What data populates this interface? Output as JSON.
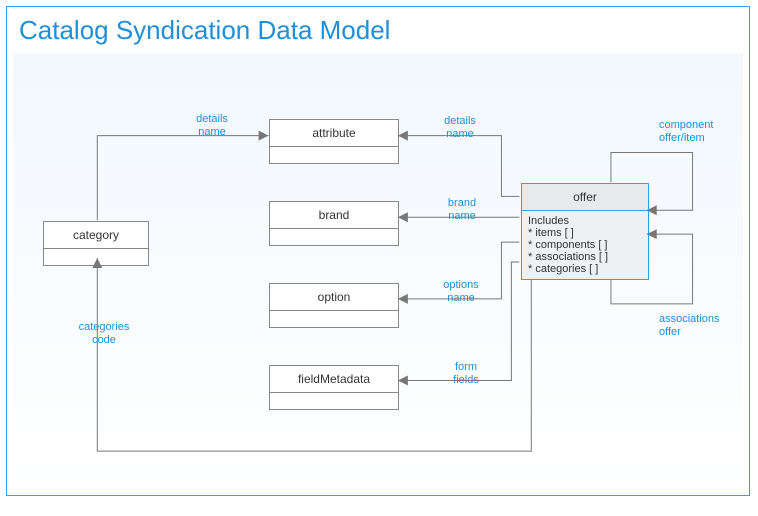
{
  "title": "Catalog Syndication Data Model",
  "entities": {
    "category": {
      "name": "category"
    },
    "attribute": {
      "name": "attribute"
    },
    "brand": {
      "name": "brand"
    },
    "option": {
      "name": "option"
    },
    "fieldMetadata": {
      "name": "fieldMetadata"
    },
    "offer": {
      "name": "offer",
      "includes_header": "Includes",
      "includes": [
        "* items [ ]",
        "* components [ ]",
        "* associations [ ]",
        "* categories [ ]"
      ]
    }
  },
  "labels": {
    "details_name_left": "details\nname",
    "details_name_right": "details\nname",
    "brand_name": "brand\nname",
    "options_name": "options\nname",
    "form_fields": "form\nfields",
    "categories_code": "categories\ncode",
    "component_offer_item": "component\noffer/item",
    "associations_offer": "associations\noffer"
  },
  "colors": {
    "accent": "#1f8fd8",
    "border": "#2ea3e6"
  }
}
